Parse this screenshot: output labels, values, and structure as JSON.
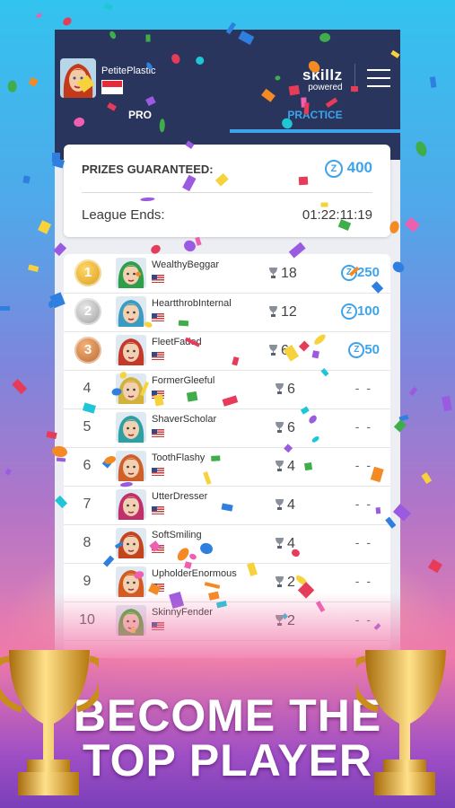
{
  "user": {
    "username": "PetitePlastic",
    "flag": "Singapore"
  },
  "brand": {
    "name": "skillz",
    "tagline": "powered"
  },
  "tabs": [
    {
      "label": "PRO"
    },
    {
      "label": "PRACTICE"
    }
  ],
  "prizes": {
    "label": "PRIZES GUARANTEED:",
    "currency_icon": "z-coin-icon",
    "amount": "400"
  },
  "league": {
    "label": "League Ends:",
    "countdown": "01:22:11:19"
  },
  "leaderboard": [
    {
      "rank": "1",
      "name": "WealthyBeggar",
      "trophies": "18",
      "prize": "250"
    },
    {
      "rank": "2",
      "name": "HeartthrobInternal",
      "trophies": "12",
      "prize": "100"
    },
    {
      "rank": "3",
      "name": "FleetFaded",
      "trophies": "6",
      "prize": "50"
    },
    {
      "rank": "4",
      "name": "FormerGleeful",
      "trophies": "6",
      "prize": "- -"
    },
    {
      "rank": "5",
      "name": "ShaverScholar",
      "trophies": "6",
      "prize": "- -"
    },
    {
      "rank": "6",
      "name": "ToothFlashy",
      "trophies": "4",
      "prize": "- -"
    },
    {
      "rank": "7",
      "name": "UtterDresser",
      "trophies": "4",
      "prize": "- -"
    },
    {
      "rank": "8",
      "name": "SoftSmiling",
      "trophies": "4",
      "prize": "- -"
    },
    {
      "rank": "9",
      "name": "UpholderEnormous",
      "trophies": "2",
      "prize": "- -"
    },
    {
      "rank": "10",
      "name": "SkinnyFender",
      "trophies": "2",
      "prize": "- -"
    }
  ],
  "headline": {
    "line1": "BECOME THE",
    "line2": "TOP PLAYER"
  },
  "colors": {
    "accent": "#3da3ea",
    "header": "#2a355d",
    "gold": "#e3a21e"
  }
}
